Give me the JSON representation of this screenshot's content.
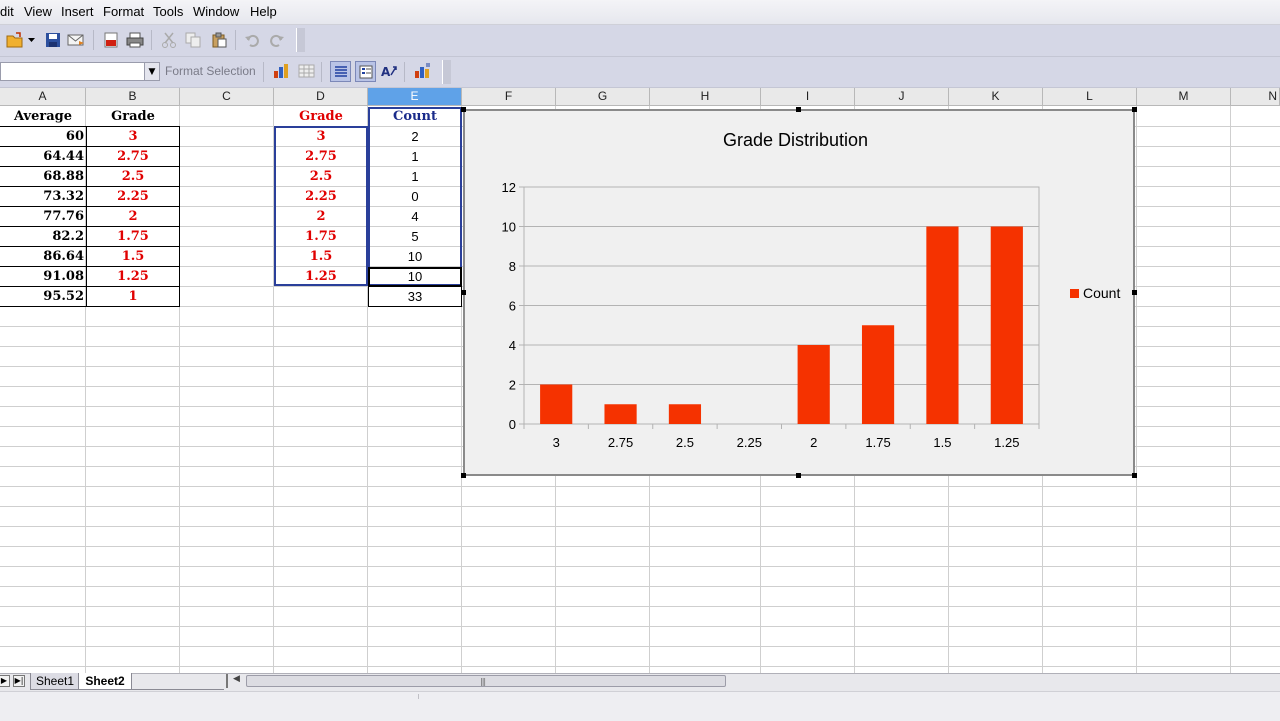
{
  "menu": [
    "dit",
    "View",
    "Insert",
    "Format",
    "Tools",
    "Window",
    "Help"
  ],
  "format_selection": "Format Selection",
  "columns": [
    "A",
    "B",
    "C",
    "D",
    "E",
    "F",
    "G",
    "H",
    "I",
    "J",
    "K",
    "L",
    "M",
    "N"
  ],
  "table1": {
    "headers": {
      "average": "Average",
      "grade": "Grade"
    },
    "rows": [
      {
        "average": "60",
        "grade": "3"
      },
      {
        "average": "64.44",
        "grade": "2.75"
      },
      {
        "average": "68.88",
        "grade": "2.5"
      },
      {
        "average": "73.32",
        "grade": "2.25"
      },
      {
        "average": "77.76",
        "grade": "2"
      },
      {
        "average": "82.2",
        "grade": "1.75"
      },
      {
        "average": "86.64",
        "grade": "1.5"
      },
      {
        "average": "91.08",
        "grade": "1.25"
      },
      {
        "average": "95.52",
        "grade": "1"
      }
    ]
  },
  "table2": {
    "headers": {
      "grade": "Grade",
      "count": "Count"
    },
    "rows": [
      {
        "grade": "3",
        "count": "2"
      },
      {
        "grade": "2.75",
        "count": "1"
      },
      {
        "grade": "2.5",
        "count": "1"
      },
      {
        "grade": "2.25",
        "count": "0"
      },
      {
        "grade": "2",
        "count": "4"
      },
      {
        "grade": "1.75",
        "count": "5"
      },
      {
        "grade": "1.5",
        "count": "10"
      },
      {
        "grade": "1.25",
        "count": "10"
      }
    ],
    "total": "33"
  },
  "sheets": [
    "Sheet1",
    "Sheet2"
  ],
  "active_sheet": "Sheet2",
  "colors": {
    "bar": "#f53200",
    "red_text": "#e00000",
    "header_blue": "#1a2b8a",
    "selected_col": "#5fa2e8"
  },
  "chart_data": {
    "type": "bar",
    "title": "Grade Distribution",
    "categories": [
      "3",
      "2.75",
      "2.5",
      "2.25",
      "2",
      "1.75",
      "1.5",
      "1.25"
    ],
    "series": [
      {
        "name": "Count",
        "values": [
          2,
          1,
          1,
          0,
          4,
          5,
          10,
          10
        ]
      }
    ],
    "ylim": [
      0,
      12
    ],
    "yticks": [
      0,
      2,
      4,
      6,
      8,
      10,
      12
    ],
    "grid": true,
    "legend": "right"
  }
}
